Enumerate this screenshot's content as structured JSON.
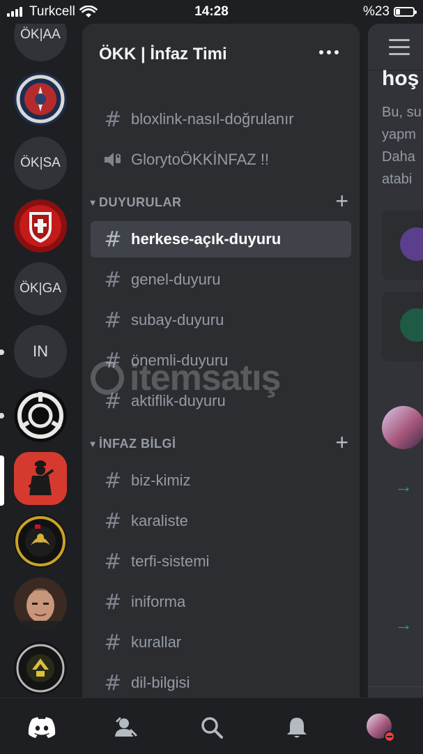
{
  "status_bar": {
    "carrier": "Turkcell",
    "time": "14:28",
    "battery_text": "%23",
    "battery_level": 0.23
  },
  "servers": [
    {
      "label": "ÖK|AA",
      "kind": "text"
    },
    {
      "label": "",
      "kind": "emblem-blue-seal"
    },
    {
      "label": "ÖK|SA",
      "kind": "text"
    },
    {
      "label": "",
      "kind": "emblem-red-shield"
    },
    {
      "label": "ÖK|GA",
      "kind": "text"
    },
    {
      "label": "IN",
      "kind": "text",
      "unread": true
    },
    {
      "label": "",
      "kind": "emblem-scp",
      "unread": true
    },
    {
      "label": "",
      "kind": "emblem-soldier",
      "selected": true
    },
    {
      "label": "",
      "kind": "emblem-gold-seal"
    },
    {
      "label": "",
      "kind": "avatar-man"
    },
    {
      "label": "",
      "kind": "emblem-black-seal"
    }
  ],
  "panel": {
    "server_name": "ÖKK | İnfaz Timi",
    "top_channels": [
      {
        "name": "bloxlink-nasıl-doğrulanır",
        "icon": "hash-icon"
      },
      {
        "name": "GlorytoÖKKİNFAZ !!",
        "icon": "speaker-icon"
      }
    ],
    "categories": [
      {
        "name": "DUYURULAR",
        "channels": [
          {
            "name": "herkese-açık-duyuru",
            "selected": true
          },
          {
            "name": "genel-duyuru"
          },
          {
            "name": "subay-duyuru"
          },
          {
            "name": "önemli-duyuru"
          },
          {
            "name": "aktiflik-duyuru"
          }
        ]
      },
      {
        "name": "İNFAZ BİLGİ",
        "channels": [
          {
            "name": "biz-kimiz"
          },
          {
            "name": "karaliste"
          },
          {
            "name": "terfi-sistemi"
          },
          {
            "name": "iniforma"
          },
          {
            "name": "kurallar"
          },
          {
            "name": "dil-bilgisi"
          }
        ]
      }
    ]
  },
  "peek": {
    "heading": "hoş",
    "lines": [
      "Bu, su",
      "yapm",
      "Daha",
      "atabi"
    ]
  },
  "watermark": {
    "text": "itemsatış"
  },
  "tabs": [
    "discord-home-icon",
    "friends-icon",
    "search-icon",
    "notifications-icon",
    "profile-avatar"
  ],
  "colors": {
    "background": "#1e1f22",
    "panel": "#2b2d31",
    "selected": "#404249",
    "online_green": "#23a55a",
    "dnd_red": "#f23f43"
  }
}
